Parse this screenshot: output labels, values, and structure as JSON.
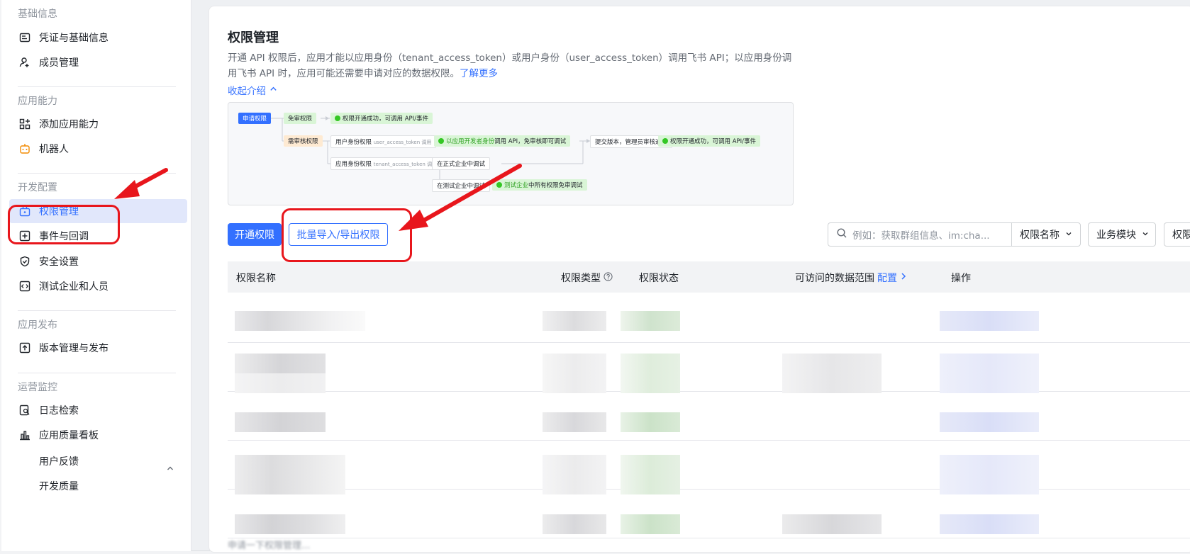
{
  "sidebar": {
    "groups": [
      {
        "title": "基础信息",
        "items": [
          {
            "label": "凭证与基础信息",
            "icon": "id-card-icon"
          },
          {
            "label": "成员管理",
            "icon": "user-add-icon"
          }
        ]
      },
      {
        "title": "应用能力",
        "items": [
          {
            "label": "添加应用能力",
            "icon": "apps-add-icon"
          },
          {
            "label": "机器人",
            "icon": "robot-icon"
          }
        ]
      },
      {
        "title": "开发配置",
        "items": [
          {
            "label": "权限管理",
            "icon": "lock-bag-icon"
          },
          {
            "label": "事件与回调",
            "icon": "event-icon"
          },
          {
            "label": "安全设置",
            "icon": "shield-icon"
          },
          {
            "label": "测试企业和人员",
            "icon": "code-box-icon"
          }
        ]
      },
      {
        "title": "应用发布",
        "items": [
          {
            "label": "版本管理与发布",
            "icon": "upload-icon"
          }
        ]
      },
      {
        "title": "运营监控",
        "items": [
          {
            "label": "日志检索",
            "icon": "log-search-icon"
          },
          {
            "label": "应用质量看板",
            "icon": "bar-chart-icon"
          }
        ]
      }
    ],
    "sub_items": [
      "用户反馈",
      "开发质量"
    ],
    "active": "权限管理"
  },
  "main": {
    "title": "权限管理",
    "desc_line1": "开通 API 权限后，应用才能以应用身份（tenant_access_token）或用户身份（user_access_token）调用飞书 API；以应用身份调",
    "desc_line2": "用飞书 API 时，应用可能还需要申请对应的数据权限。",
    "learn_more": "了解更多",
    "collapse": "收起介绍",
    "diagram": {
      "apply": "申请权限",
      "free": "免审权限",
      "free_ok": "权限开通成功，可调用 API/事件",
      "need_review": "需审核权限",
      "user_identity": "用户身份权限",
      "user_token": "user_access_token 调用",
      "dev_identity_pre": "以应用开发者身份",
      "dev_identity_post": "调用 API，免审核即可调试",
      "submit": "提交版本，管理员审核通过",
      "success": "权限开通成功，可调用 API/事件",
      "app_identity": "应用身份权限",
      "tenant_token": "tenant_access_token 调用",
      "formal": "在正式企业中调试",
      "test_ent": "在测试企业中调试",
      "test_free_pre": "测试企业",
      "test_free_post": "中所有权限免审调试"
    },
    "buttons": {
      "open": "开通权限",
      "batch": "批量导入/导出权限"
    },
    "search_placeholder": "例如：获取群组信息、im:cha...",
    "filters": [
      "权限名称",
      "业务模块",
      "权限"
    ],
    "table_headers": {
      "name": "权限名称",
      "type": "权限类型",
      "status": "权限状态",
      "scope": "可访问的数据范围",
      "config": "配置",
      "op": "操作"
    },
    "bottom_text": "申请一下权限管理..."
  },
  "colors": {
    "accent": "#3370ff",
    "annotation": "#e8161c",
    "active_bg": "#e1e7fb"
  }
}
